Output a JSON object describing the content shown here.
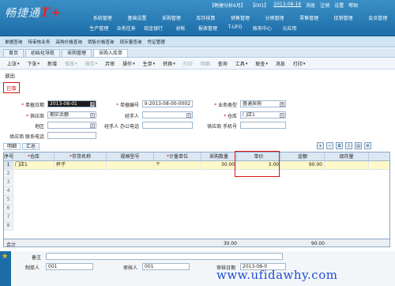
{
  "header": {
    "logo_text": "畅捷通",
    "logo_mark": "T+",
    "info": [
      "【畅捷分析6月】",
      "【001】",
      "2013-08-16",
      "消息",
      "注销",
      "设置",
      "帮助"
    ],
    "menu_row1": [
      "基础设置",
      "采购管理",
      "库存核算",
      "销售管理",
      "分销管理",
      "零售管理",
      "促销管理",
      "会员管理"
    ],
    "menu_row1_prefix": "系统管理",
    "menu_row2": [
      "生产管理",
      "业务往来",
      "现金银行",
      "总帐",
      "报表管理",
      "T-UFO",
      "账务中心",
      "元应用"
    ]
  },
  "quickbar": [
    "单据查询",
    "待审核业务",
    "采购价格查询",
    "销售价格查询",
    "现存量查询",
    "凭证管理"
  ],
  "tabs": [
    "首页",
    "初始化导航",
    "采购管理",
    "采购入库单"
  ],
  "toolbar": [
    "上张",
    "下张",
    "新增",
    "修改",
    "保存",
    "弃审",
    "操作",
    "生单",
    "转换",
    "打印",
    "明细",
    "查询",
    "工具",
    "联查",
    "消息",
    "打印"
  ],
  "exit": "退出",
  "status": "已审",
  "form": {
    "date_label": "单据日期",
    "date_value": "2013-08-01",
    "no_label": "单据编号",
    "no_value": "II-2013-08-00-0002",
    "biztype_label": "业务类型",
    "biztype_value": "普通采购",
    "supplier_label": "供应商",
    "supplier_value": "期实余额",
    "handler_label": "经手人",
    "warehouse_label": "仓库",
    "warehouse_value": "门店1",
    "region_label": "地区",
    "phone_label": "经手人 办公电话",
    "sup_phone_label": "供应商 手机号",
    "sup_tel_label": "供应商 联系电话"
  },
  "subtabs": [
    "明细",
    "汇总"
  ],
  "grid": {
    "headers": [
      "序号",
      "仓库",
      "存货名称",
      "规格型号",
      "计量单位",
      "采购数量",
      "单价",
      "金额",
      "现存量"
    ],
    "row": {
      "no": "1",
      "warehouse": "门店1",
      "item": "杯子",
      "spec": "",
      "unit": "个",
      "qty": "30.00",
      "price": "3.00",
      "amount": "90.00",
      "stock": ""
    },
    "row_numbers": [
      "1",
      "2",
      "3",
      "4",
      "5",
      "6",
      "7",
      "8"
    ]
  },
  "totals": {
    "label": "合计",
    "qty": "30.00",
    "amount": "90.00"
  },
  "footer": {
    "remark_label": "备注",
    "maker_label": "制单人",
    "maker_value": "001",
    "auditor_label": "审核人",
    "auditor_value": "001",
    "audit_date_label": "审核日期",
    "audit_date_value": "2013-08-0"
  },
  "watermark": "www.ufidawhy.com"
}
